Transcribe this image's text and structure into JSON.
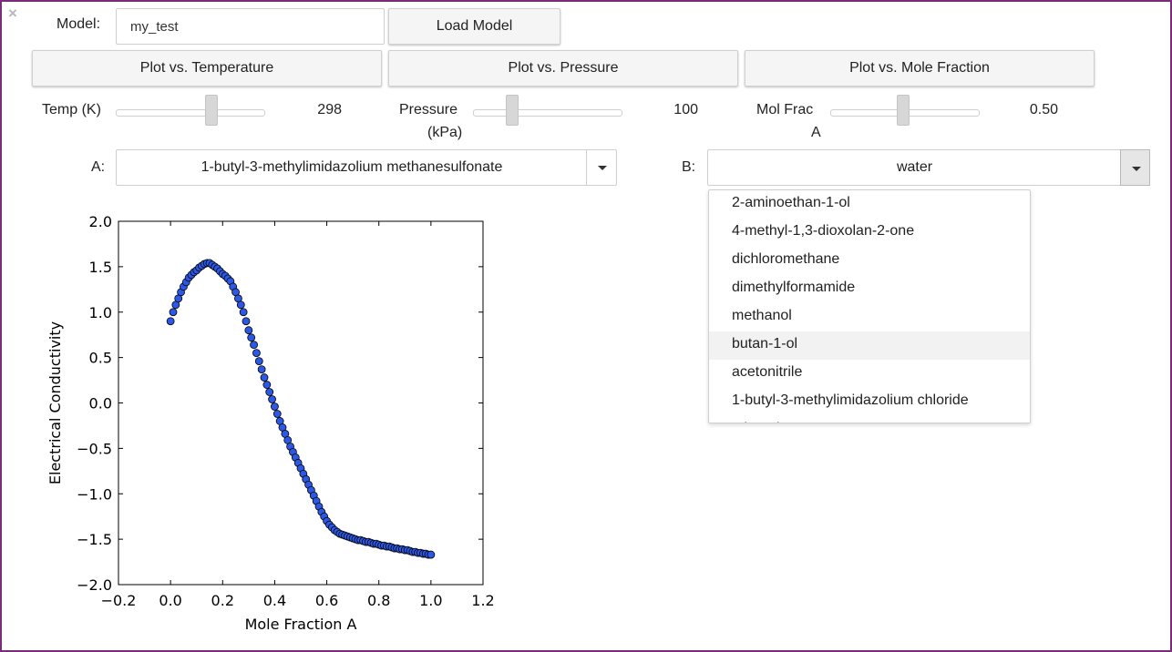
{
  "window": {
    "close_glyph": "×"
  },
  "model": {
    "label": "Model:",
    "value": "my_test",
    "load_button": "Load Model"
  },
  "plot_buttons": [
    "Plot vs. Temperature",
    "Plot vs. Pressure",
    "Plot vs. Mole Fraction"
  ],
  "sliders": [
    {
      "label": "Temp (K)",
      "value": "298",
      "level": 0.5
    },
    {
      "label": "Pressure",
      "label2": "(kPa)",
      "value": "100",
      "level": 0.25
    },
    {
      "label": "Mol Frac",
      "label2": "A",
      "value": "0.50",
      "level": 0.5
    }
  ],
  "select_a": {
    "label": "A:",
    "value": "1-butyl-3-methylimidazolium methanesulfonate"
  },
  "select_b": {
    "label": "B:",
    "value": "water",
    "options": [
      "2-aminoethan-1-ol",
      "4-methyl-1,3-dioxolan-2-one",
      "dichloromethane",
      "dimethylformamide",
      "methanol",
      "butan-1-ol",
      "acetonitrile",
      "1-butyl-3-methylimidazolium chloride",
      "ethanol"
    ],
    "highlighted_option": "butan-1-ol"
  },
  "colors": {
    "accent_frame": "#7b2b7b",
    "marker_fill": "#2b59e6",
    "marker_edge": "#000000"
  },
  "chart_data": {
    "type": "scatter",
    "xlabel": "Mole Fraction A",
    "ylabel": "Electrical Conductivity",
    "xlim": [
      -0.2,
      1.2
    ],
    "ylim": [
      -2.0,
      2.0
    ],
    "xticks": [
      "−0.2",
      "0.0",
      "0.2",
      "0.4",
      "0.6",
      "0.8",
      "1.0",
      "1.2"
    ],
    "yticks": [
      "2.0",
      "1.5",
      "1.0",
      "0.5",
      "0.0",
      "−0.5",
      "−1.0",
      "−1.5",
      "−2.0"
    ],
    "grid": false,
    "series": [
      {
        "x": [
          0.0,
          0.01,
          0.02,
          0.03,
          0.04,
          0.05,
          0.06,
          0.07,
          0.08,
          0.09,
          0.1,
          0.11,
          0.12,
          0.13,
          0.14,
          0.15,
          0.16,
          0.17,
          0.18,
          0.19,
          0.2,
          0.21,
          0.22,
          0.23,
          0.24,
          0.25,
          0.26,
          0.27,
          0.28,
          0.29,
          0.3,
          0.31,
          0.32,
          0.33,
          0.34,
          0.35,
          0.36,
          0.37,
          0.38,
          0.39,
          0.4,
          0.41,
          0.42,
          0.43,
          0.44,
          0.45,
          0.46,
          0.47,
          0.48,
          0.49,
          0.5,
          0.51,
          0.52,
          0.53,
          0.54,
          0.55,
          0.56,
          0.57,
          0.58,
          0.59,
          0.6,
          0.61,
          0.62,
          0.63,
          0.64,
          0.65,
          0.66,
          0.67,
          0.68,
          0.69,
          0.7,
          0.71,
          0.72,
          0.73,
          0.74,
          0.75,
          0.76,
          0.77,
          0.78,
          0.79,
          0.8,
          0.81,
          0.82,
          0.83,
          0.84,
          0.85,
          0.86,
          0.87,
          0.88,
          0.89,
          0.9,
          0.91,
          0.92,
          0.93,
          0.94,
          0.95,
          0.96,
          0.97,
          0.98,
          0.99,
          1.0
        ],
        "y": [
          0.9,
          1.0,
          1.08,
          1.15,
          1.22,
          1.28,
          1.33,
          1.38,
          1.41,
          1.44,
          1.46,
          1.49,
          1.51,
          1.53,
          1.54,
          1.54,
          1.52,
          1.5,
          1.48,
          1.45,
          1.42,
          1.4,
          1.37,
          1.34,
          1.28,
          1.22,
          1.15,
          1.08,
          1.0,
          0.9,
          0.8,
          0.72,
          0.64,
          0.55,
          0.46,
          0.37,
          0.28,
          0.2,
          0.12,
          0.04,
          -0.04,
          -0.12,
          -0.2,
          -0.27,
          -0.34,
          -0.41,
          -0.48,
          -0.54,
          -0.6,
          -0.66,
          -0.72,
          -0.78,
          -0.84,
          -0.9,
          -0.96,
          -1.02,
          -1.08,
          -1.14,
          -1.2,
          -1.25,
          -1.3,
          -1.34,
          -1.37,
          -1.4,
          -1.42,
          -1.44,
          -1.45,
          -1.46,
          -1.47,
          -1.48,
          -1.49,
          -1.5,
          -1.51,
          -1.51,
          -1.52,
          -1.53,
          -1.53,
          -1.54,
          -1.55,
          -1.55,
          -1.56,
          -1.57,
          -1.57,
          -1.58,
          -1.58,
          -1.59,
          -1.6,
          -1.6,
          -1.61,
          -1.61,
          -1.62,
          -1.62,
          -1.63,
          -1.64,
          -1.64,
          -1.65,
          -1.65,
          -1.66,
          -1.66,
          -1.67,
          -1.67
        ]
      }
    ]
  }
}
